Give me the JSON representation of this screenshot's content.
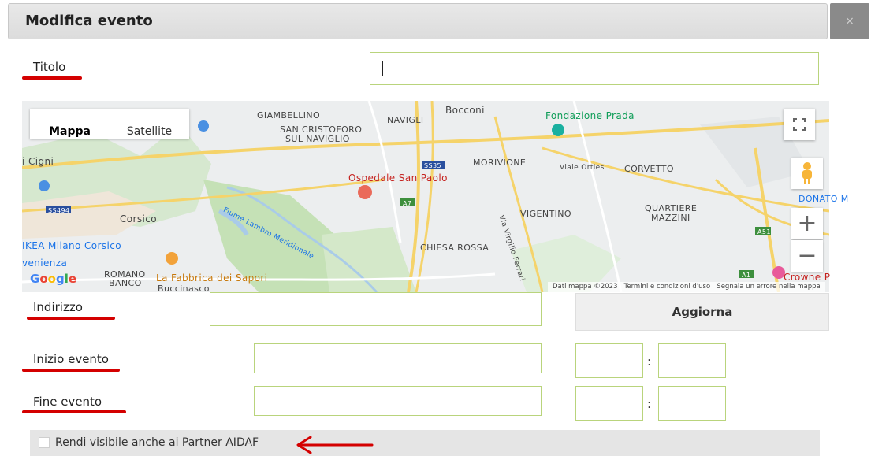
{
  "dialog": {
    "title": "Modifica evento",
    "close_label": "×"
  },
  "form": {
    "titolo": {
      "label": "Titolo",
      "value": ""
    },
    "indirizzo": {
      "label": "Indirizzo",
      "value": ""
    },
    "inizio_evento": {
      "label": "Inizio evento",
      "date": "",
      "hour": "",
      "minute": ""
    },
    "fine_evento": {
      "label": "Fine evento",
      "date": "",
      "hour": "",
      "minute": ""
    },
    "time_separator": ":",
    "aggiorna_label": "Aggiorna",
    "partner_visibility": {
      "label": "Rendi visibile anche ai Partner AIDAF",
      "checked": false
    }
  },
  "map": {
    "tabs": [
      "Mappa",
      "Satellite"
    ],
    "active_tab": "Mappa",
    "zoom_in": "+",
    "zoom_out": "−",
    "footer": [
      "Dati mappa ©2023",
      "Termini e condizioni d'uso",
      "Segnala un errore nella mappa"
    ],
    "places": {
      "giambellino": "GIAMBELLINO",
      "san_cristoforo": "SAN CRISTOFORO",
      "sul_naviglio": "SUL NAVIGLIO",
      "navigli": "NAVIGLI",
      "bocconi": "Bocconi",
      "fondazione_prada": "Fondazione Prada",
      "morivione": "MORIVIONE",
      "viale_ortles": "Viale Ortles",
      "corvetto": "CORVETTO",
      "ospedale": "Ospedale San Paolo",
      "corsico": "Corsico",
      "vigentino": "VIGENTINO",
      "quartiere": "QUARTIERE",
      "mazzini": "MAZZINI",
      "donato": "DONATO M",
      "fiume": "Fiume Lambro Meridionale",
      "ikea": "IKEA Milano Corsico",
      "chiesa_rossa": "CHIESA ROSSA",
      "venienza": "venienza",
      "romano": "ROMANO",
      "banco": "BANCO",
      "fabbrica": "La Fabbrica dei Sapori",
      "buccinasco": "Buccinasco",
      "cigni": "i Cigni",
      "crowne": "Crowne P",
      "via_vigilio": "Via Virgilio Ferrari",
      "road_ss35": "SS35",
      "road_ss494": "SS494",
      "road_a7": "A7",
      "road_a51": "A51",
      "road_a1": "A1",
      "google": "Google"
    }
  },
  "colors": {
    "field_border": "#b9d47c",
    "underline": "#d40000",
    "header_bg": "#e0e0e0"
  }
}
